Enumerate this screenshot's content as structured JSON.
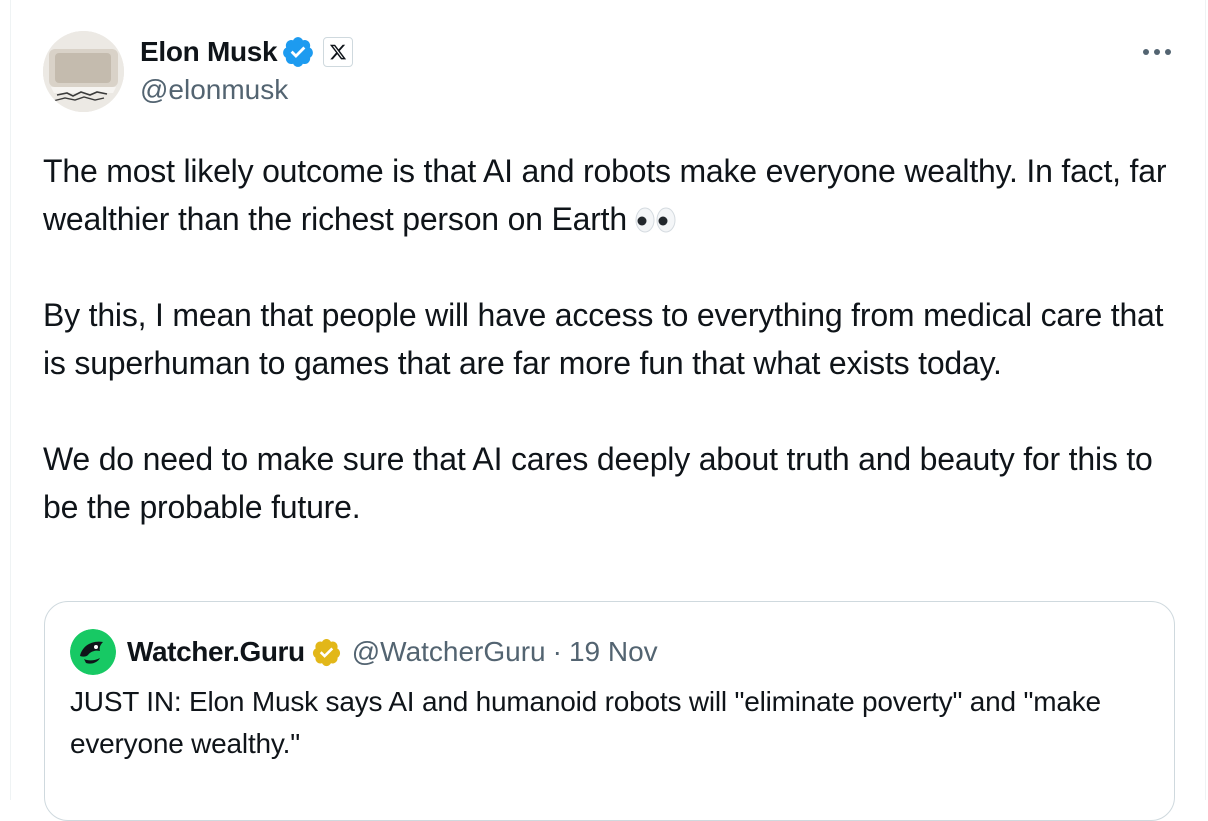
{
  "author": {
    "display_name": "Elon Musk",
    "handle": "@elonmusk",
    "verified": true,
    "affiliate_badge_icon": "x-logo-icon"
  },
  "tweet": {
    "paragraphs": [
      "The most likely outcome is that AI and robots make everyone wealthy. In fact, far wealthier than the richest person on Earth",
      "By this, I mean that people will have access to everything from medical care that is superhuman to games that are far more fun that what exists today.",
      "We do need to make sure that AI cares deeply about truth and beauty for this to be the probable future."
    ],
    "trailing_emoji": "eyes-emoji"
  },
  "more_menu_icon": "ellipsis-icon",
  "quoted_tweet": {
    "display_name": "Watcher.Guru",
    "handle": "@WatcherGuru",
    "separator": "·",
    "timestamp": "19 Nov",
    "verified_badge": "gold-verified-icon",
    "text": "JUST IN: Elon Musk says AI and humanoid robots will \"eliminate poverty\" and \"make everyone wealthy.\""
  },
  "colors": {
    "text_primary": "#0f1419",
    "text_secondary": "#536471",
    "verified_blue": "#1d9bf0",
    "verified_gold": "#e2b719",
    "border": "#cfd9de",
    "watcher_green": "#17c964"
  }
}
